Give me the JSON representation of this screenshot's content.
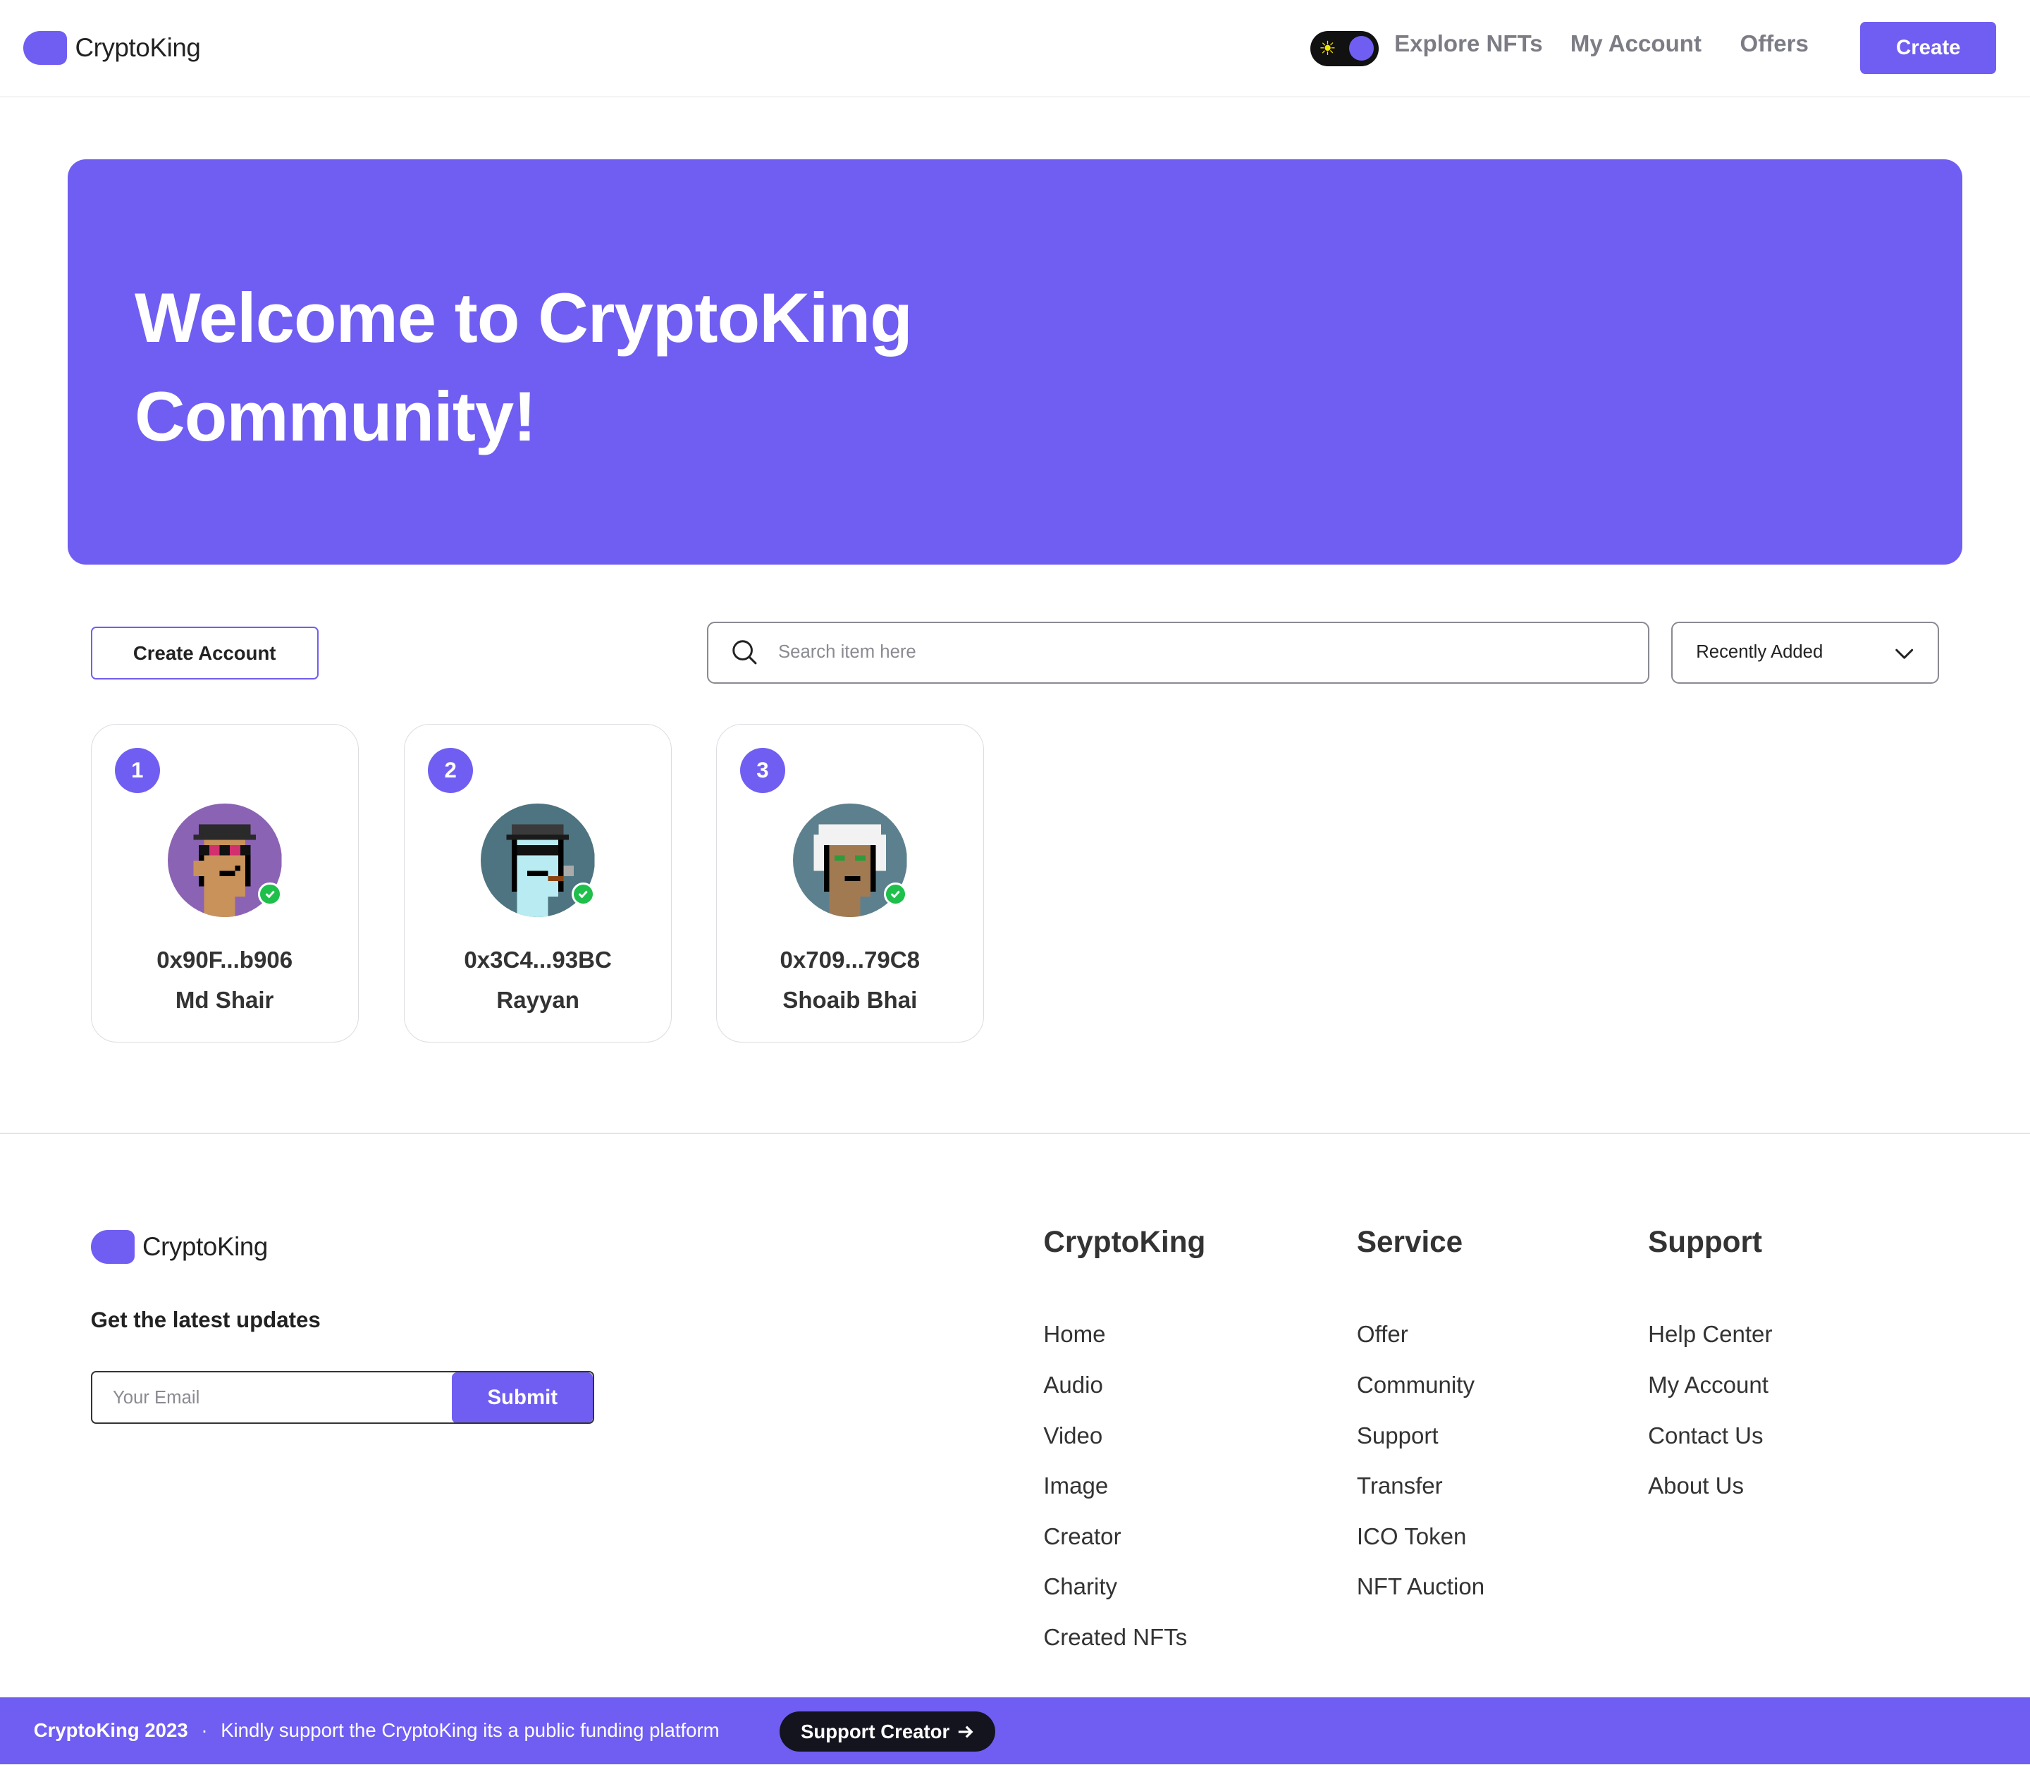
{
  "header": {
    "logo_text": "CryptoKing",
    "nav": [
      "Explore NFTs",
      "My Account",
      "Offers"
    ],
    "create_label": "Create",
    "theme_toggle_icon": "sun-icon"
  },
  "hero": {
    "title_line1": "Welcome to CryptoKing",
    "title_line2": "Community!",
    "background_color": "#705ef2"
  },
  "controls": {
    "create_account_label": "Create Account",
    "search_placeholder": "Search item here",
    "sort_value": "Recently Added"
  },
  "creators": [
    {
      "rank": "1",
      "address": "0x90F...b906",
      "name": "Md Shair",
      "avatar_bg": "#8b63b4",
      "verified": true
    },
    {
      "rank": "2",
      "address": "0x3C4...93BC",
      "name": "Rayyan",
      "avatar_bg": "#4d7480",
      "verified": true
    },
    {
      "rank": "3",
      "address": "0x709...79C8",
      "name": "Shoaib Bhai",
      "avatar_bg": "#5d808e",
      "verified": true
    }
  ],
  "footer": {
    "logo_text": "CryptoKing",
    "updates_label": "Get the latest updates",
    "email_placeholder": "Your Email",
    "submit_label": "Submit",
    "columns": [
      {
        "title": "CryptoKing",
        "links": [
          "Home",
          "Audio",
          "Video",
          "Image",
          "Creator",
          "Charity",
          "Created NFTs"
        ]
      },
      {
        "title": "Service",
        "links": [
          "Offer",
          "Community",
          "Support",
          "Transfer",
          "ICO Token",
          "NFT Auction"
        ]
      },
      {
        "title": "Support",
        "links": [
          "Help Center",
          "My Account",
          "Contact Us",
          "About Us"
        ]
      }
    ]
  },
  "bottom_bar": {
    "brand_year": "CryptoKing 2023",
    "separator": "·",
    "message": "Kindly support the CryptoKing its a public funding platform",
    "support_label": "Support Creator"
  },
  "colors": {
    "accent": "#705ef2",
    "verified": "#1fbf4b",
    "dark": "#14141f"
  }
}
